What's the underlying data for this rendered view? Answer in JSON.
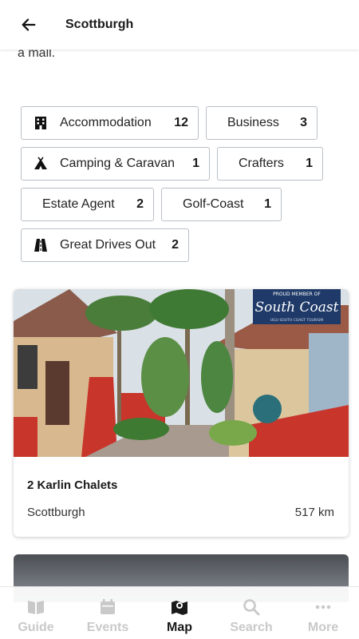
{
  "header": {
    "title": "Scottburgh",
    "back_icon": "arrow-left-icon"
  },
  "intro_text": "a mall.",
  "categories": [
    {
      "label": "Accommodation",
      "count": "12",
      "icon": "hotel-icon"
    },
    {
      "label": "Business",
      "count": "3",
      "icon": ""
    },
    {
      "label": "Camping & Caravan",
      "count": "1",
      "icon": "tent-icon"
    },
    {
      "label": "Crafters",
      "count": "1",
      "icon": ""
    },
    {
      "label": "Estate Agent",
      "count": "2",
      "icon": ""
    },
    {
      "label": "Golf-Coast",
      "count": "1",
      "icon": ""
    },
    {
      "label": "Great Drives Out",
      "count": "2",
      "icon": "road-icon"
    }
  ],
  "listing": {
    "name": "2 Karlin Chalets",
    "location": "Scottburgh",
    "distance": "517 km",
    "badge": {
      "top_text": "PROUD MEMBER OF",
      "sub_text": "UGU SOUTH COAST TOURISM",
      "brand": "South Coast"
    }
  },
  "bottom_nav": [
    {
      "label": "Guide",
      "icon": "book-icon",
      "active": false
    },
    {
      "label": "Events",
      "icon": "calendar-icon",
      "active": false
    },
    {
      "label": "Map",
      "icon": "map-icon",
      "active": true
    },
    {
      "label": "Search",
      "icon": "search-icon",
      "active": false
    },
    {
      "label": "More",
      "icon": "more-icon",
      "active": false
    }
  ],
  "colors": {
    "active": "#1a1a1a",
    "inactive": "#c9c9c9",
    "chip_border": "#b9bfc6",
    "badge_bg": "#1f3a68",
    "wall_red": "#c8352b"
  }
}
